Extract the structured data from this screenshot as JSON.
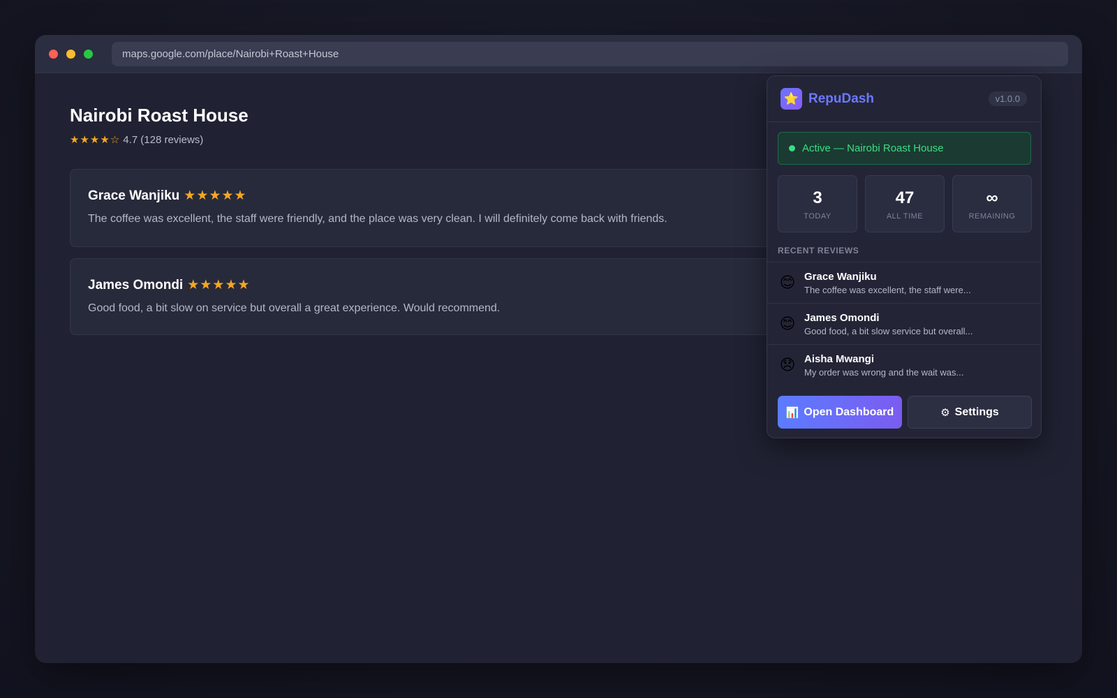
{
  "browser": {
    "url": "maps.google.com/place/Nairobi+Roast+House"
  },
  "place": {
    "title": "Nairobi Roast House",
    "stars": "★★★★☆",
    "rating_text": "4.7 (128 reviews)"
  },
  "reviews": [
    {
      "author": "Grace Wanjiku",
      "stars": "★★★★★",
      "text": "The coffee was excellent, the staff were friendly, and the place was very clean. I will definitely come back with friends."
    },
    {
      "author": "James Omondi",
      "stars": "★★★★★",
      "text": "Good food, a bit slow on service but overall a great experience. Would recommend."
    }
  ],
  "extension": {
    "name": "RepuDash",
    "version": "v1.0.0",
    "logo_icon": "⭐",
    "status": "Active — Nairobi Roast House",
    "stats": [
      {
        "value": "3",
        "label": "TODAY"
      },
      {
        "value": "47",
        "label": "ALL TIME"
      },
      {
        "value": "∞",
        "label": "REMAINING"
      }
    ],
    "recent_label": "RECENT REVIEWS",
    "recent": [
      {
        "emoji": "😊",
        "name": "Grace Wanjiku",
        "snippet": "The coffee was excellent, the staff were..."
      },
      {
        "emoji": "😊",
        "name": "James Omondi",
        "snippet": "Good food, a bit slow service but overall..."
      },
      {
        "emoji": "😞",
        "name": "Aisha Mwangi",
        "snippet": "My order was wrong and the wait was..."
      }
    ],
    "open_dashboard_icon": "📊",
    "open_dashboard_label": "Open Dashboard",
    "settings_icon": "⚙",
    "settings_label": "Settings"
  },
  "colors": {
    "accent": "#6b79ff",
    "star": "#f5a623",
    "status_green": "#3ddc84"
  }
}
